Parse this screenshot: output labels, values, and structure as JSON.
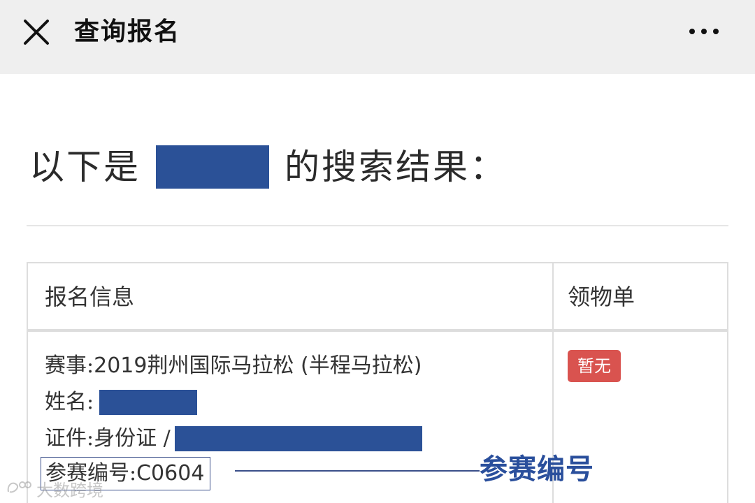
{
  "navbar": {
    "title": "查询报名",
    "close_icon": "close-icon",
    "more_icon": "more-dots-icon"
  },
  "heading": {
    "prefix": "以下是",
    "suffix": "的搜索结果："
  },
  "table": {
    "headers": {
      "info": "报名信息",
      "slip": "领物单"
    },
    "row": {
      "event_label": "赛事: ",
      "event_value": "2019荆州国际马拉松 (半程马拉松)",
      "name_label": "姓名:",
      "id_label": "证件: ",
      "id_type": "身份证 /",
      "bib_label": "参赛编号: ",
      "bib_value": "C0604",
      "slip_status": "暂无"
    }
  },
  "annotation": {
    "label": "参赛编号"
  },
  "watermark": {
    "text": "大数跨境"
  },
  "colors": {
    "redaction": "#2b5197",
    "badge_bg": "#d9534f",
    "annotation": "#2a4f9c",
    "navbar_bg": "#efefef"
  }
}
